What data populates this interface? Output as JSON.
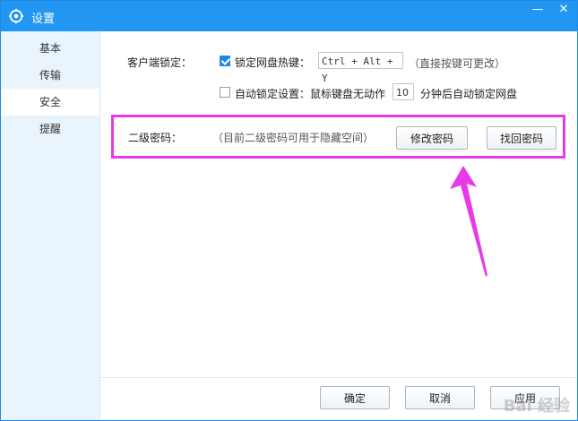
{
  "window": {
    "title": "设置",
    "minimize": "—",
    "close": "✕"
  },
  "sidebar": {
    "items": [
      {
        "label": "基本"
      },
      {
        "label": "传输"
      },
      {
        "label": "安全"
      },
      {
        "label": "提醒"
      }
    ],
    "active_index": 2
  },
  "security": {
    "client_lock_label": "客户端锁定：",
    "hotkey_checkbox_label": "锁定网盘热键：",
    "hotkey_checked": true,
    "hotkey_value": "Ctrl + Alt + Y",
    "hotkey_hint": "（直接按键可更改）",
    "auto_lock_label": "自动锁定设置：鼠标键盘无动作",
    "auto_lock_checked": false,
    "auto_lock_minutes": "10",
    "auto_lock_suffix": "分钟后自动锁定网盘",
    "second_password_label": "二级密码：",
    "second_password_hint": "（目前二级密码可用于隐藏空间）",
    "change_password_button": "修改密码",
    "recover_password_button": "找回密码"
  },
  "footer": {
    "ok_button": "确定",
    "cancel_button": "取消",
    "apply_button": "应用"
  },
  "watermark": "Bai 经验",
  "colors": {
    "titlebar": "#2196f3",
    "highlight": "#e83be8",
    "arrow": "#e83be8"
  }
}
